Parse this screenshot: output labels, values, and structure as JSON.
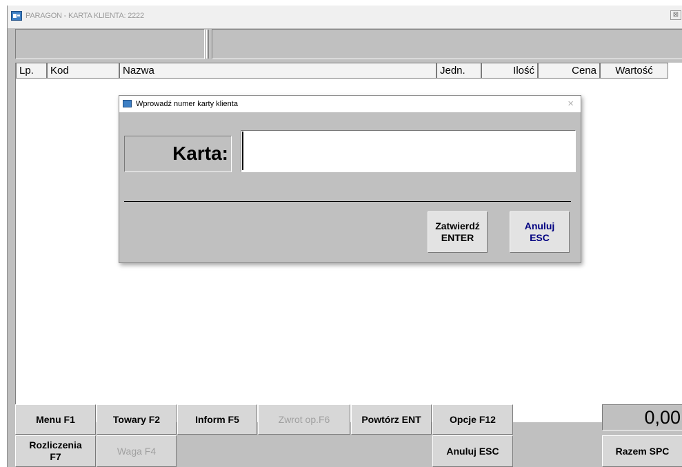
{
  "window": {
    "title": "PARAGON - KARTA KLIENTA: 2222",
    "close_glyph": "⊠"
  },
  "table": {
    "columns": [
      "Lp.",
      "Kod",
      "Nazwa",
      "Jedn.",
      "Ilość",
      "Cena",
      "Wartość"
    ]
  },
  "buttons": {
    "menu": "Menu F1",
    "towary": "Towary F2",
    "inform": "Inform F5",
    "zwrot": "Zwrot op.F6",
    "powtorz": "Powtórz ENT",
    "opcje": "Opcje F12",
    "rozliczenia_line1": "Rozliczenia",
    "rozliczenia_line2": "F7",
    "waga": "Waga F4",
    "anuluj": "Anuluj ESC",
    "razem": "Razem SPC"
  },
  "total": "0,00",
  "dialog": {
    "title": "Wprowadź numer karty klienta",
    "close_glyph": "×",
    "label": "Karta:",
    "input_value": "",
    "confirm_line1": "Zatwierdź",
    "confirm_line2": "ENTER",
    "cancel_line1": "Anuluj",
    "cancel_line2": "ESC"
  },
  "colors": {
    "background": "#c0c0c0",
    "list_background": "#ffffff",
    "cancel_text": "#000080",
    "disabled_text": "#a0a0a0"
  }
}
